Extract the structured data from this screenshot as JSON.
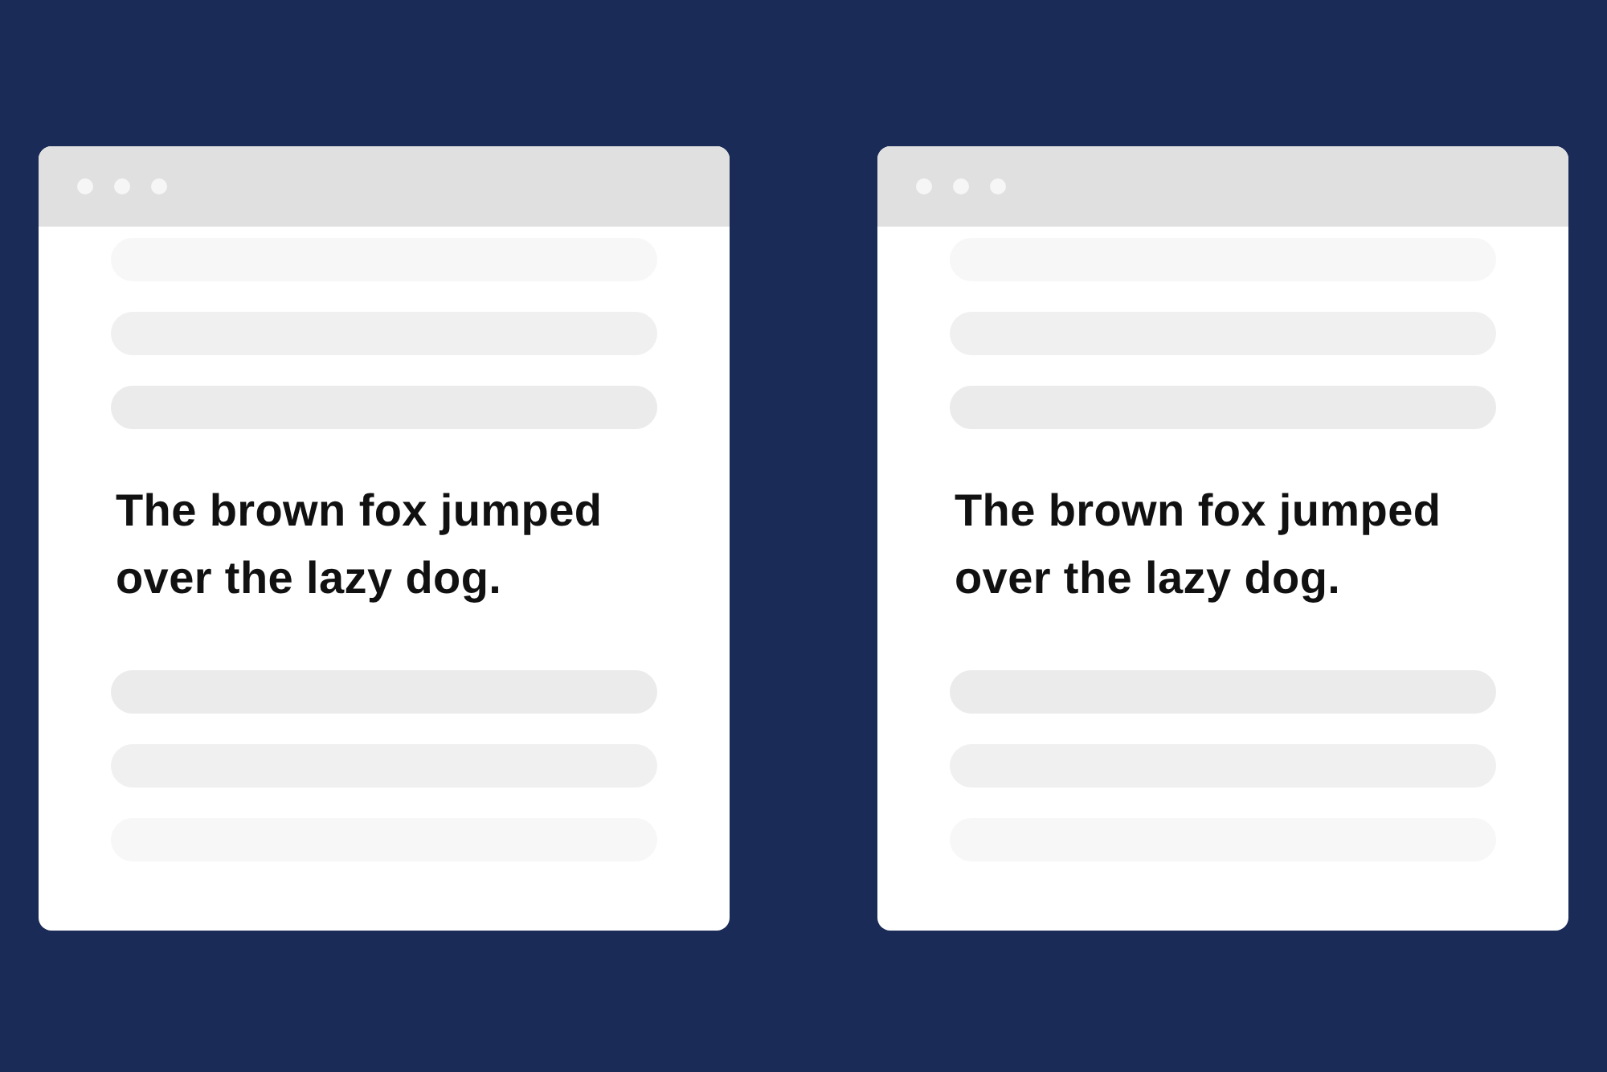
{
  "windows": [
    {
      "text": "The brown fox jumped over the lazy dog."
    },
    {
      "text": "The brown fox jumped over the lazy dog."
    }
  ]
}
